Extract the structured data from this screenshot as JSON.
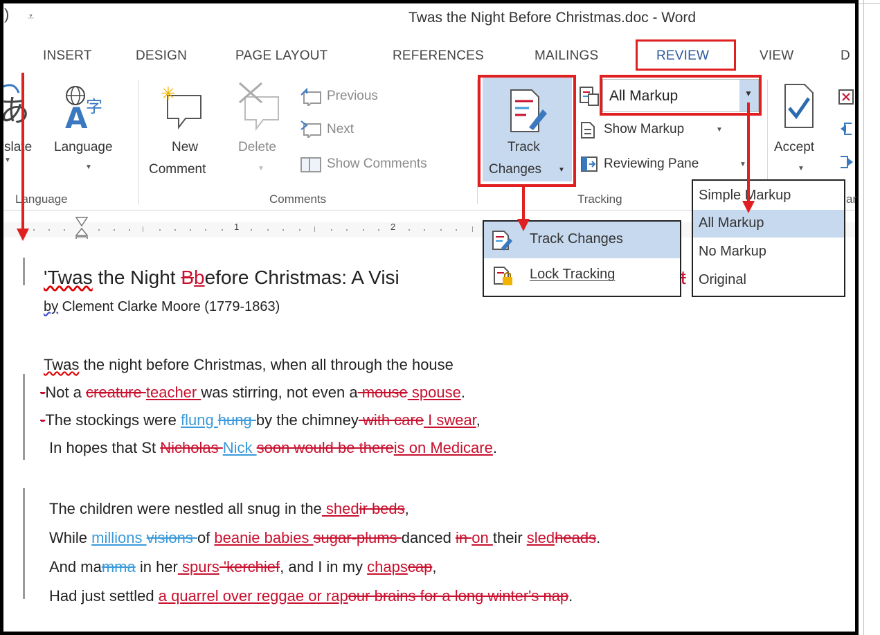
{
  "window": {
    "qat_arrow": "₹",
    "title": "Twas the Night Before Christmas.doc - Word"
  },
  "tabs": [
    "INSERT",
    "DESIGN",
    "PAGE LAYOUT",
    "REFERENCES",
    "MAILINGS",
    "REVIEW",
    "VIEW",
    "D"
  ],
  "active_tab": "REVIEW",
  "ribbon": {
    "language_group": {
      "translate_label": "slate",
      "language_label": "Language",
      "group_label": "Language"
    },
    "comments_group": {
      "new_comment_line1": "New",
      "new_comment_line2": "Comment",
      "delete_label": "Delete",
      "previous_label": "Previous",
      "next_label": "Next",
      "show_comments_label": "Show Comments",
      "group_label": "Comments"
    },
    "tracking_group": {
      "track_changes_line1": "Track",
      "track_changes_line2": "Changes",
      "display_for_review_value": "All Markup",
      "show_markup_label": "Show Markup",
      "reviewing_pane_label": "Reviewing Pane",
      "group_label": "Tracking"
    },
    "changes_group": {
      "accept_label": "Accept",
      "group_label_fragment": "ar"
    }
  },
  "ruler": {
    "numbers": [
      "1",
      "2"
    ]
  },
  "track_changes_menu": {
    "items": [
      "Track Changes",
      "Lock Tracking"
    ],
    "selected_index": 0
  },
  "markup_menu": {
    "items": [
      "Simple Markup",
      "All Markup",
      "No Markup",
      "Original"
    ],
    "selected_index": 1
  },
  "document": {
    "title": {
      "w1": "'Twas",
      "w2": " the Night ",
      "del": "B",
      "ins": "b",
      "w3": "efore Christmas: A Visi",
      "cut": "t"
    },
    "byline": {
      "by": "by",
      "rest": " Clement Clarke Moore (1779-1863)"
    },
    "stanza1": {
      "l1_twas": "Twas",
      "l1_rest": " the night before Christmas, when all through the house",
      "l2_dash": "-",
      "l2_a": "Not a ",
      "l2_del1": "creature ",
      "l2_ins1": "teacher ",
      "l2_b": "was stirring, not even a",
      "l2_del2": " mouse",
      "l2_ins2": " spouse",
      "l2_end": ".",
      "l3_dash": "-",
      "l3_a": "The stockings were ",
      "l3_ins1": "flung ",
      "l3_del1": "hung ",
      "l3_b": "by the chimney",
      "l3_del2": " with care",
      "l3_ins2": " I swear",
      "l3_end": ",",
      "l4_a": "In hopes that St ",
      "l4_del1": "Nicholas ",
      "l4_ins1": "Nick ",
      "l4_del2": "soon would be there",
      "l4_ins2": "is on Medicare",
      "l4_end": "."
    },
    "stanza2": {
      "l1_a": "The children were nestled all snug in the",
      "l1_ins": " shed",
      "l1_del": "ir beds",
      "l1_end": ",",
      "l2_a": "While ",
      "l2_ins1": "millions ",
      "l2_del1": "visions ",
      "l2_b": "of ",
      "l2_ins2": "beanie babies ",
      "l2_del2": "sugar-plums ",
      "l2_c": "danced ",
      "l2_del3": "in ",
      "l2_ins3": "on ",
      "l2_d": "their ",
      "l2_ins4": "sled",
      "l2_del4": "heads",
      "l2_end": ".",
      "l3_a": "And ma",
      "l3_del1": "mma",
      "l3_b": " in her",
      "l3_ins1": " spurs",
      "l3_del2": " 'kerchief",
      "l3_c": ", and I in my ",
      "l3_ins2": "chaps",
      "l3_del3": "cap",
      "l3_end": ",",
      "l4_a": "Had just settled ",
      "l4_ins1": "a quarrel over reggae or rap",
      "l4_del1": "our brains for a long winter's nap",
      "l4_end": "."
    }
  },
  "colors": {
    "annotation_red": "#e02020",
    "deletion_red": "#c8102e",
    "insertion_blue": "#3a9ad9",
    "highlight_blue": "#c7d9ef",
    "active_tab_blue": "#2b579a"
  }
}
